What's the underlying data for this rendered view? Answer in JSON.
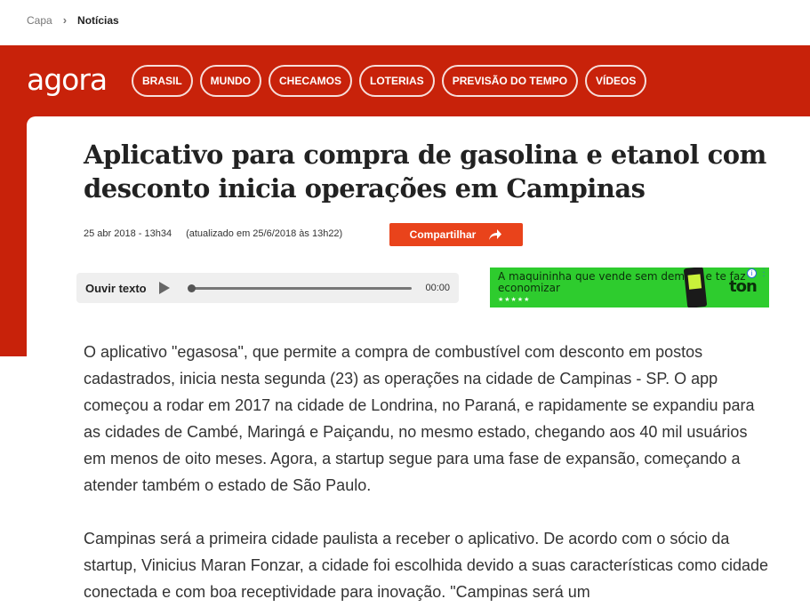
{
  "breadcrumb": {
    "home": "Capa",
    "current": "Notícias"
  },
  "header": {
    "logo": "agora",
    "nav": [
      "BRASIL",
      "MUNDO",
      "CHECAMOS",
      "LOTERIAS",
      "PREVISÃO DO TEMPO",
      "VÍDEOS"
    ],
    "brand_color": "#c8220a"
  },
  "article": {
    "title": "Aplicativo para compra de gasolina e etanol com desconto inicia operações em Campinas",
    "published": "25 abr 2018 - 13h34",
    "updated": "(atualizado em 25/6/2018 às 13h22)",
    "share_label": "Compartilhar",
    "paragraphs": [
      "O aplicativo \"egasosa\", que permite a compra de combustível com desconto em postos cadastrados, inicia nesta segunda (23) as operações na cidade de Campinas - SP. O app começou a rodar em 2017 na cidade de Londrina, no Paraná, e rapidamente se expandiu para as cidades de Cambé, Maringá e Paiçandu, no mesmo estado, chegando aos 40 mil usuários em menos de oito meses. Agora, a startup segue para uma fase de expansão, começando a atender também o estado de São Paulo.",
      "Campinas será a primeira cidade paulista a receber o aplicativo. De acordo com o sócio da startup, Vinicius Maran Fonzar, a cidade foi escolhida devido a suas características como cidade conectada e com boa receptividade para inovação. \"Campinas será um"
    ]
  },
  "audio_player": {
    "label": "Ouvir texto",
    "time": "00:00",
    "progress": 0
  },
  "ad": {
    "text": "A maquininha que vende sem demora e te faz economizar",
    "brand": "ton",
    "stars": "★★★★★"
  },
  "icons": {
    "share": "share-arrow-icon",
    "play": "play-icon",
    "info": "info-icon",
    "more": "more-vertical-icon"
  }
}
